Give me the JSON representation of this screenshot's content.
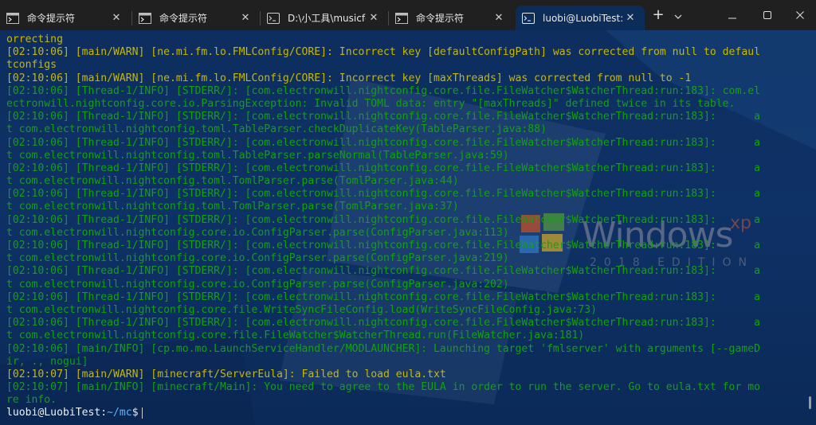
{
  "tabs": [
    {
      "label": "命令提示符",
      "icon": "cmd-icon"
    },
    {
      "label": "命令提示符",
      "icon": "cmd-icon"
    },
    {
      "label": "D:\\小工具\\musicfox.",
      "icon": "terminal-icon"
    },
    {
      "label": "命令提示符",
      "icon": "cmd-icon"
    },
    {
      "label": "luobi@LuobiTest: ~/",
      "icon": "linux-terminal-icon",
      "active": true
    }
  ],
  "controls": {
    "new_tab": "+",
    "dropdown": "⌄",
    "minimize": "—",
    "maximize": "☐",
    "close": "✕"
  },
  "colors": {
    "info": "#13a10e",
    "warn": "#c8b800",
    "background": "#0c2c5a"
  },
  "wallpaper": {
    "wordmark": "Windows",
    "superscript": "xp",
    "edition": "2018 EDITION"
  },
  "terminal_lines": [
    {
      "type": "warn",
      "text": "orrecting"
    },
    {
      "type": "warn",
      "text": "[02:10:06] [main/WARN] [ne.mi.fm.lo.FMLConfig/CORE]: Incorrect key [defaultConfigPath] was corrected from null to defaul"
    },
    {
      "type": "warn",
      "text": "tconfigs"
    },
    {
      "type": "warn",
      "text": "[02:10:06] [main/WARN] [ne.mi.fm.lo.FMLConfig/CORE]: Incorrect key [maxThreads] was corrected from null to -1"
    },
    {
      "type": "info",
      "text": "[02:10:06] [Thread-1/INFO] [STDERR/]: [com.electronwill.nightconfig.core.file.FileWatcher$WatcherThread:run:183]: com.el"
    },
    {
      "type": "info",
      "text": "ectronwill.nightconfig.core.io.ParsingException: Invalid TOML data: entry \"[maxThreads]\" defined twice in its table."
    },
    {
      "type": "info",
      "text": "[02:10:06] [Thread-1/INFO] [STDERR/]: [com.electronwill.nightconfig.core.file.FileWatcher$WatcherThread:run:183]:      a"
    },
    {
      "type": "info",
      "text": "t com.electronwill.nightconfig.toml.TableParser.checkDuplicateKey(TableParser.java:88)"
    },
    {
      "type": "info",
      "text": "[02:10:06] [Thread-1/INFO] [STDERR/]: [com.electronwill.nightconfig.core.file.FileWatcher$WatcherThread:run:183]:      a"
    },
    {
      "type": "info",
      "text": "t com.electronwill.nightconfig.toml.TableParser.parseNormal(TableParser.java:59)"
    },
    {
      "type": "info",
      "text": "[02:10:06] [Thread-1/INFO] [STDERR/]: [com.electronwill.nightconfig.core.file.FileWatcher$WatcherThread:run:183]:      a"
    },
    {
      "type": "info",
      "text": "t com.electronwill.nightconfig.toml.TomlParser.parse(TomlParser.java:44)"
    },
    {
      "type": "info",
      "text": "[02:10:06] [Thread-1/INFO] [STDERR/]: [com.electronwill.nightconfig.core.file.FileWatcher$WatcherThread:run:183]:      a"
    },
    {
      "type": "info",
      "text": "t com.electronwill.nightconfig.toml.TomlParser.parse(TomlParser.java:37)"
    },
    {
      "type": "info",
      "text": "[02:10:06] [Thread-1/INFO] [STDERR/]: [com.electronwill.nightconfig.core.file.FileWatcher$WatcherThread:run:183]:      a"
    },
    {
      "type": "info",
      "text": "t com.electronwill.nightconfig.core.io.ConfigParser.parse(ConfigParser.java:113)"
    },
    {
      "type": "info",
      "text": "[02:10:06] [Thread-1/INFO] [STDERR/]: [com.electronwill.nightconfig.core.file.FileWatcher$WatcherThread:run:183]:      a"
    },
    {
      "type": "info",
      "text": "t com.electronwill.nightconfig.core.io.ConfigParser.parse(ConfigParser.java:219)"
    },
    {
      "type": "info",
      "text": "[02:10:06] [Thread-1/INFO] [STDERR/]: [com.electronwill.nightconfig.core.file.FileWatcher$WatcherThread:run:183]:      a"
    },
    {
      "type": "info",
      "text": "t com.electronwill.nightconfig.core.io.ConfigParser.parse(ConfigParser.java:202)"
    },
    {
      "type": "info",
      "text": "[02:10:06] [Thread-1/INFO] [STDERR/]: [com.electronwill.nightconfig.core.file.FileWatcher$WatcherThread:run:183]:      a"
    },
    {
      "type": "info",
      "text": "t com.electronwill.nightconfig.core.file.WriteSyncFileConfig.load(WriteSyncFileConfig.java:73)"
    },
    {
      "type": "info",
      "text": "[02:10:06] [Thread-1/INFO] [STDERR/]: [com.electronwill.nightconfig.core.file.FileWatcher$WatcherThread:run:183]:      a"
    },
    {
      "type": "info",
      "text": "t com.electronwill.nightconfig.core.file.FileWatcher$WatcherThread.run(FileWatcher.java:181)"
    },
    {
      "type": "info",
      "text": "[02:10:06] [main/INFO] [cp.mo.mo.LaunchServiceHandler/MODLAUNCHER]: Launching target 'fmlserver' with arguments [--gameD"
    },
    {
      "type": "info",
      "text": "ir, ., nogui]"
    },
    {
      "type": "warn",
      "text": "[02:10:07] [main/WARN] [minecraft/ServerEula]: Failed to load eula.txt"
    },
    {
      "type": "info",
      "text": "[02:10:07] [main/INFO] [minecraft/Main]: You need to agree to the EULA in order to run the server. Go to eula.txt for mo"
    },
    {
      "type": "info",
      "text": "re info."
    }
  ],
  "prompt": {
    "user_host": "luobi@LuobiTest",
    "separator": ":",
    "path": "~/mc",
    "symbol": "$"
  }
}
